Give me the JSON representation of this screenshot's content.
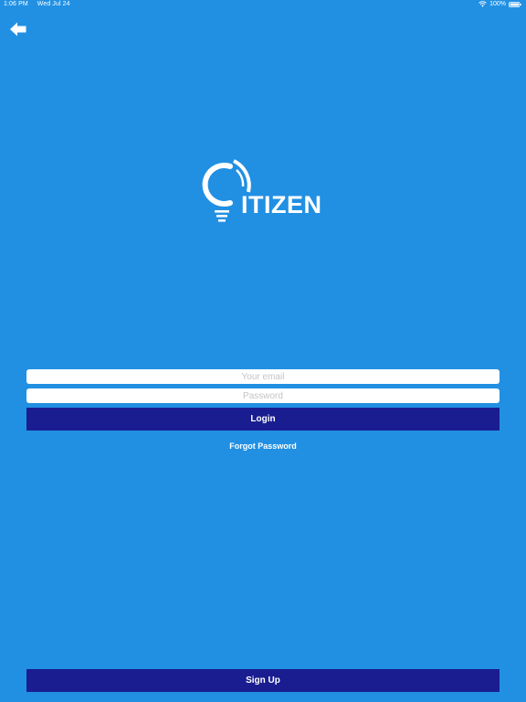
{
  "status_bar": {
    "time": "1:06 PM",
    "date": "Wed Jul 24",
    "battery": "100%"
  },
  "icons": {
    "back": "back-arrow-icon",
    "wifi": "wifi-icon",
    "battery": "battery-icon",
    "logo": "lightbulb-logo-icon"
  },
  "logo": {
    "text": "ITIZEN"
  },
  "login_form": {
    "email_placeholder": "Your email",
    "email_value": "",
    "password_placeholder": "Password",
    "password_value": "",
    "login_label": "Login",
    "forgot_label": "Forgot Password"
  },
  "footer": {
    "signup_label": "Sign Up"
  },
  "colors": {
    "background": "#2190e3",
    "button": "#1a1d8f",
    "text": "#ffffff"
  }
}
